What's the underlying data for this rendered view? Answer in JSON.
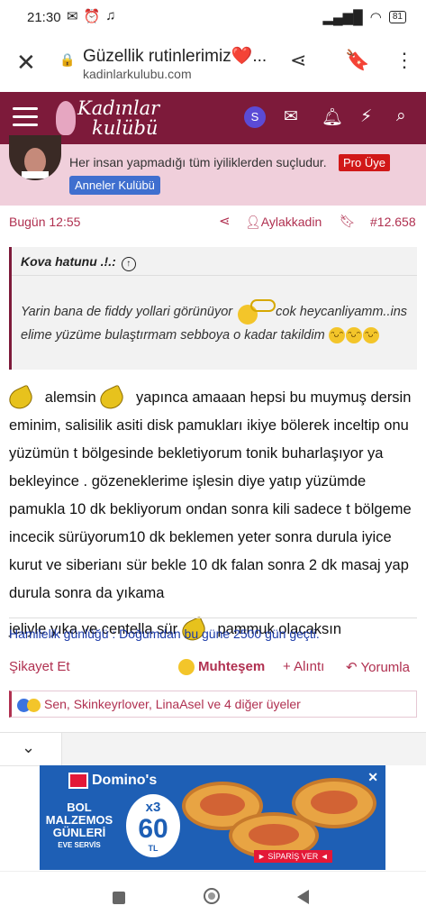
{
  "status_bar": {
    "time": "21:30",
    "battery": "81"
  },
  "browser": {
    "title": "Güzellik rutinlerimiz❤️...",
    "domain": "kadinlarkulubu.com"
  },
  "site": {
    "logo_line1": "Kadınlar",
    "logo_line2": "kulübü",
    "user_initial": "S",
    "header_color": "#7d1a3a"
  },
  "author": {
    "motto": "Her insan yapmadığı tüm iyiliklerden suçludur.",
    "pro_badge": "Pro Üye",
    "group_badge": "Anneler Kulübü"
  },
  "post_meta": {
    "date": "Bugün 12:55",
    "tag": "Aylakkadin",
    "number": "#12.658"
  },
  "quote": {
    "author": "Kova hatunu .!.:",
    "text1": "Yarin bana de fiddy yollari görünüyor",
    "text2": "cok heycanliyamm..ins elime yüzüme bulaştırmam sebboya o kadar takildim"
  },
  "post": {
    "t1": "alemsin",
    "t2": "yapınca amaaan hepsi bu muymuş dersin eminim, salisilik asiti disk pamukları ikiye bölerek inceltip onu yüzümün t bölgesinde bekletiyorum tonik buharlaşıyor ya bekleyince . gözeneklerime işlesin diye yatıp yüzümde pamukla 10 dk bekliyorum ondan sonra kili sadece t bölgeme incecik sürüyorum10 dk beklemen yeter sonra durula iyice kurut ve siberianı sür bekle 10 dk falan sonra 2 dk masaj yap durula sonra da yıkama",
    "t3": "jeliyle yıka ve centella sür",
    "t4": "pammuk olacaksın"
  },
  "signature": "Hamilelik günlüğü : Doğumdan bu güne 2500 gün geçti.",
  "actions": {
    "report": "Şikayet Et",
    "reaction": "Muhteşem",
    "quote": "+ Alıntı",
    "reply": "Yorumla"
  },
  "reactions_text": "Sen, Skinkeyrlover, LinaAsel ve 4 diğer üyeler",
  "ad": {
    "brand": "Domino's",
    "line1": "BOL",
    "line2": "MALZEMOS",
    "line3": "GÜNLERİ",
    "line4": "EVE SERVİS",
    "multiplier": "x3",
    "price": "60",
    "currency": "TL",
    "cta": "► SİPARİŞ VER ◄"
  }
}
